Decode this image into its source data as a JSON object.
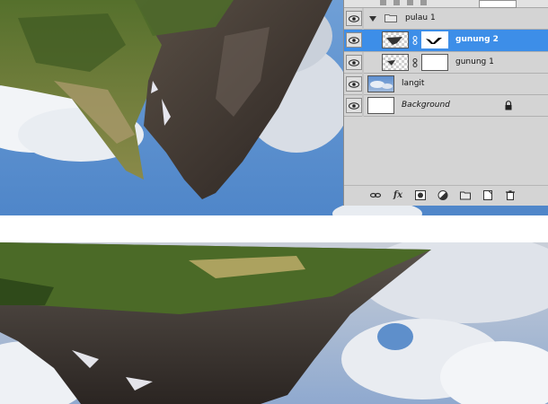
{
  "layers_panel": {
    "layers": [
      {
        "name": "pulau 1",
        "type": "group",
        "expanded": true,
        "selected": false,
        "visible": true
      },
      {
        "name": "gunung 2",
        "type": "layer-with-mask",
        "selected": true,
        "visible": true
      },
      {
        "name": "gunung 1",
        "type": "layer-with-mask",
        "selected": false,
        "visible": true
      },
      {
        "name": "langit",
        "type": "image-layer",
        "selected": false,
        "visible": true
      },
      {
        "name": "Background",
        "type": "background",
        "locked": true,
        "selected": false,
        "visible": true
      }
    ],
    "footer_icons": [
      "link-layers-icon",
      "fx-icon",
      "add-mask-icon",
      "adjustment-layer-icon",
      "new-group-icon",
      "new-layer-icon",
      "delete-layer-icon"
    ],
    "footer_fx_label": "fx",
    "selection_color": "#3d8ee8"
  },
  "canvas": {
    "top_image": "upside-down-mountain-over-blue-sky",
    "bottom_image": "upside-down-floating-island-with-clouds"
  }
}
